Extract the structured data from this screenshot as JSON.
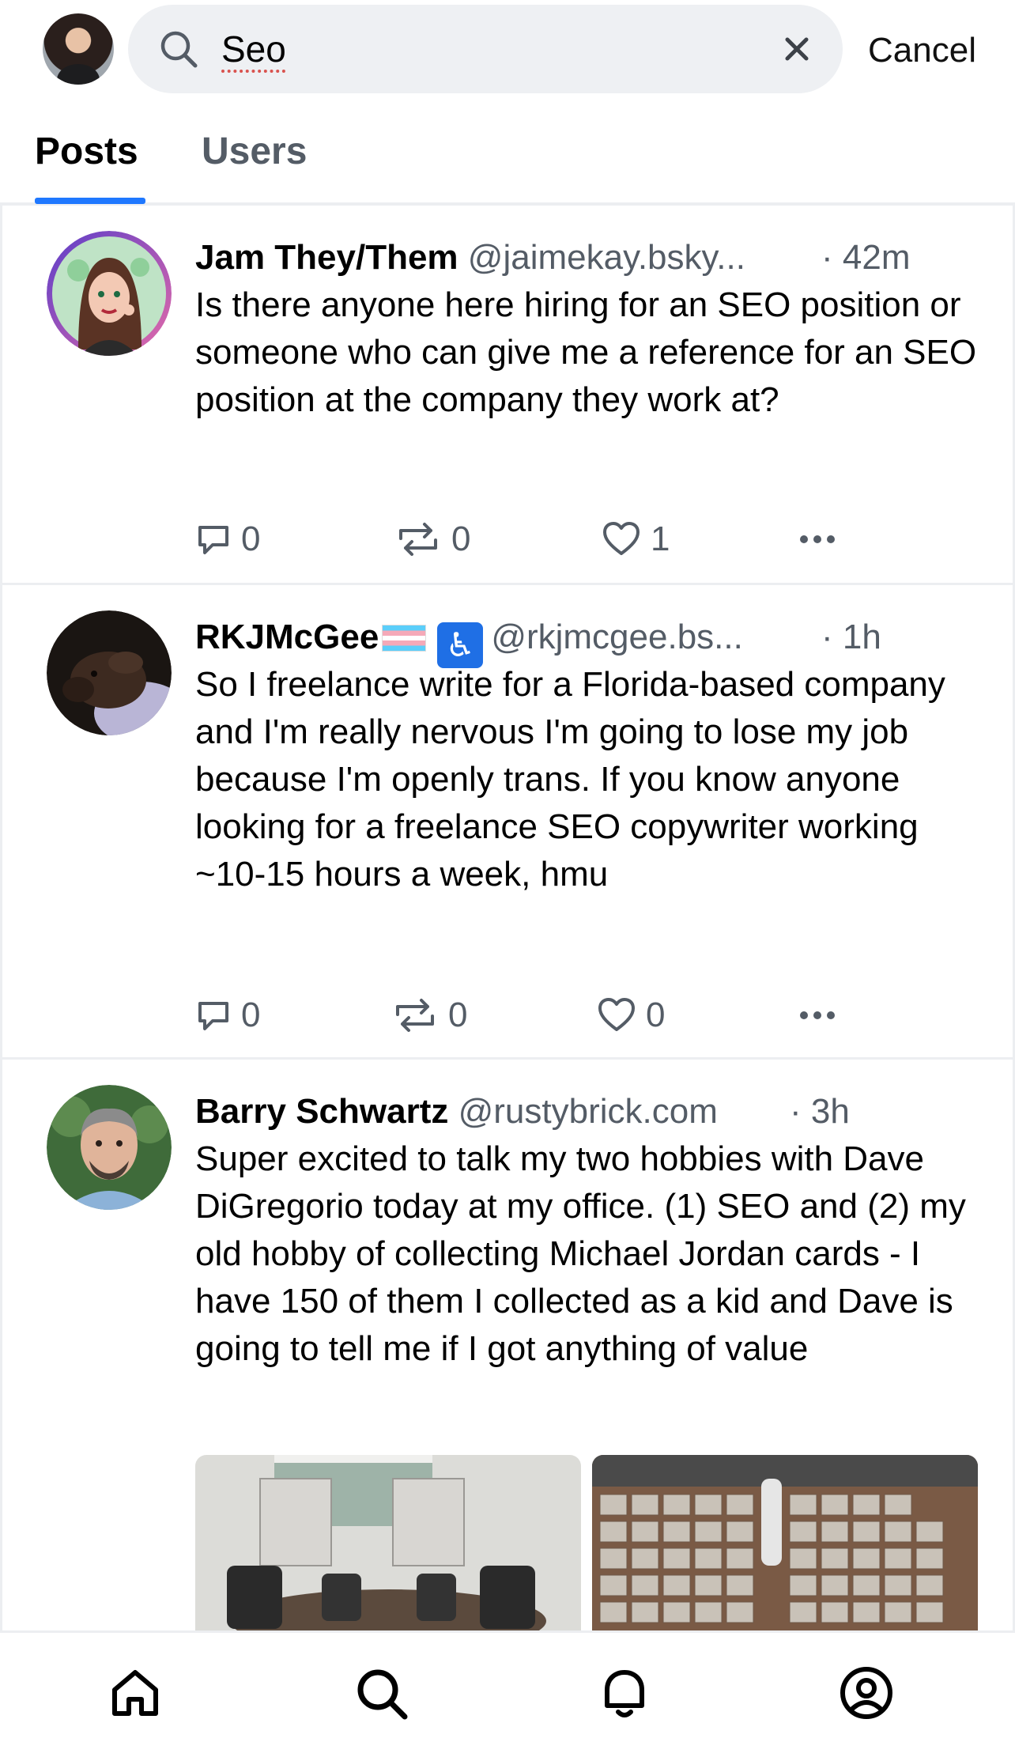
{
  "search": {
    "query": "Seo",
    "cancel_label": "Cancel"
  },
  "tabs": [
    {
      "label": "Posts",
      "active": true
    },
    {
      "label": "Users",
      "active": false
    }
  ],
  "posts": [
    {
      "name": "Jam They/Them",
      "handle": "@jaimekay.bsky...",
      "time": "· 42m",
      "text": "Is there anyone here hiring for an SEO position or someone who can give me a reference for an SEO position at the company they work at?",
      "replies": "0",
      "reposts": "0",
      "likes": "1"
    },
    {
      "name": "RKJMcGee",
      "handle": "@rkjmcgee.bs...",
      "time": "· 1h",
      "text": "So I freelance write for a Florida-based company and I'm really nervous I'm going to lose my job because I'm openly trans. If you know anyone looking for a freelance SEO copywriter working ~10-15 hours a week, hmu",
      "replies": "0",
      "reposts": "0",
      "likes": "0"
    },
    {
      "name": "Barry Schwartz",
      "handle": "@rustybrick.com",
      "time": "· 3h",
      "text": "Super excited to talk my two hobbies with Dave DiGregorio today at my office.  (1) SEO and (2) my old hobby of collecting Michael Jordan cards - I have 150 of them I collected as a kid and Dave is going to tell me if I got anything of value"
    }
  ],
  "colors": {
    "accent": "#1f78ff",
    "muted_text": "#545c66",
    "divider": "#eceef1"
  },
  "icons": [
    "search-icon",
    "close-icon",
    "reply-icon",
    "repost-icon",
    "like-icon",
    "more-icon",
    "home-icon",
    "notifications-icon",
    "profile-icon"
  ]
}
